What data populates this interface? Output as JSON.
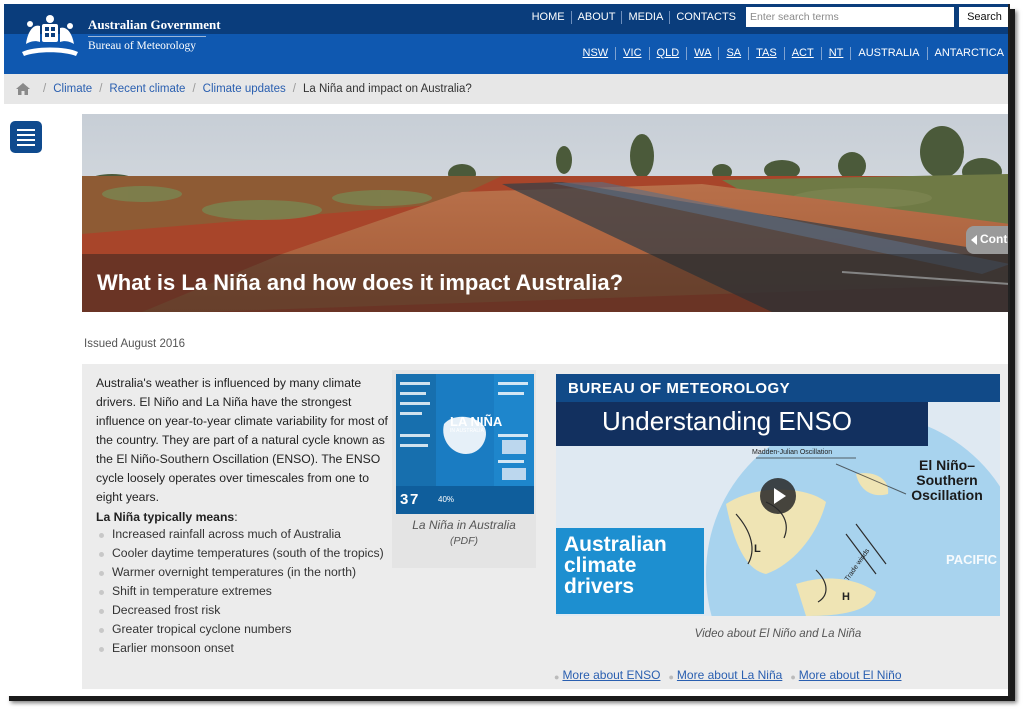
{
  "header": {
    "gov_title": "Australian Government",
    "agency": "Bureau of Meteorology",
    "top_nav": [
      "HOME",
      "ABOUT",
      "MEDIA",
      "CONTACTS"
    ],
    "search_placeholder": "Enter search terms",
    "search_button": "Search",
    "state_nav": [
      "NSW",
      "VIC",
      "QLD",
      "WA",
      "SA",
      "TAS",
      "ACT",
      "NT",
      "AUSTRALIA",
      "ANTARCTICA"
    ],
    "colors": {
      "dark": "#0a3d7c",
      "light": "#0f58b0"
    }
  },
  "breadcrumb": {
    "home_icon": "home-icon",
    "items": [
      "Climate",
      "Recent climate",
      "Climate updates"
    ],
    "current": "La Niña and impact on Australia?"
  },
  "menu": {
    "icon": "hamburger-menu-icon"
  },
  "hero": {
    "title": "What is La Niña and how does it impact Australia?",
    "contents_tab": "Cont"
  },
  "issued": "Issued August 2016",
  "article": {
    "intro": "Australia's weather is influenced by many climate drivers. El Niño and La Niña have the strongest influence on year-to-year climate variability for most of the country. They are part of a natural cycle known as the El Niño-Southern Oscillation (ENSO). The ENSO cycle loosely operates over timescales from one to eight years.",
    "means_heading": "La Niña typically means",
    "means_colon": ":",
    "means_items": [
      "Increased rainfall across much of Australia",
      "Cooler daytime temperatures (south of the tropics)",
      "Warmer overnight temperatures (in the north)",
      "Shift in temperature extremes",
      "Decreased frost risk",
      "Greater tropical cyclone numbers",
      "Earlier monsoon onset"
    ]
  },
  "pdf": {
    "caption": "La Niña in Australia",
    "sub": "(PDF)",
    "thumb_title": "LA NIÑA",
    "thumb_sub": "IN AUSTRALIA"
  },
  "video": {
    "org": "BUREAU OF METEOROLOGY",
    "title": "Understanding ENSO",
    "enso_label": "El Niño– Southern Oscillation",
    "pacific": "PACIFIC",
    "drivers": "Australian climate drivers",
    "caption": "Video about El Niño and La Niña",
    "play_icon": "play-icon"
  },
  "links": [
    "More about ENSO",
    "More about La Niña",
    "More about El Niño"
  ]
}
